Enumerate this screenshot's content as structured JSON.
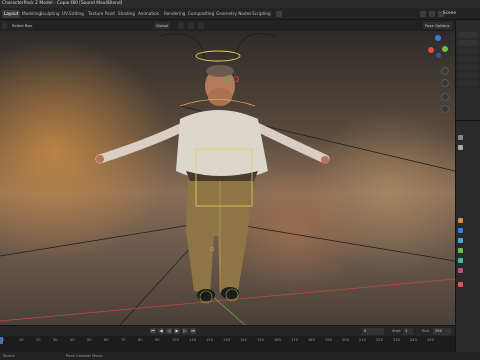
{
  "window": {
    "title": "CharacterPack 2 Model - Copie.f80 [Sound Max4Blend]"
  },
  "workspaces": [
    "Layout",
    "Modeling",
    "Sculpting",
    "UV Editing",
    "Texture Paint",
    "Shading",
    "Animation",
    "Rendering",
    "Compositing",
    "Geometry Nodes",
    "Scripting"
  ],
  "active_workspace": "Layout",
  "scene": {
    "label": "Scene"
  },
  "header": {
    "select_box": "Select Box",
    "transform_orientation": "Global",
    "snap": "",
    "options_label": "Pose Options"
  },
  "viewport": {
    "icons": [
      "zoom-icon",
      "pan-icon",
      "camera-icon",
      "grid-icon"
    ]
  },
  "timeline": {
    "current_frame": "0",
    "start_label": "Start",
    "start": "1",
    "end_label": "End",
    "end": "250",
    "ticks": [
      "0",
      "10",
      "20",
      "30",
      "40",
      "50",
      "60",
      "70",
      "80",
      "90",
      "100",
      "110",
      "120",
      "130",
      "140",
      "150",
      "160",
      "170",
      "180",
      "190",
      "200",
      "210",
      "220",
      "230",
      "240",
      "250"
    ]
  },
  "status": {
    "left": "Select",
    "middle": "Pose Context Menu"
  },
  "colors": {
    "accent": "#4772b3",
    "x_axis": "#e04a4a",
    "y_axis": "#6fbf3d",
    "z_axis": "#3e7de0",
    "bone_selected": "#e6d15a"
  }
}
